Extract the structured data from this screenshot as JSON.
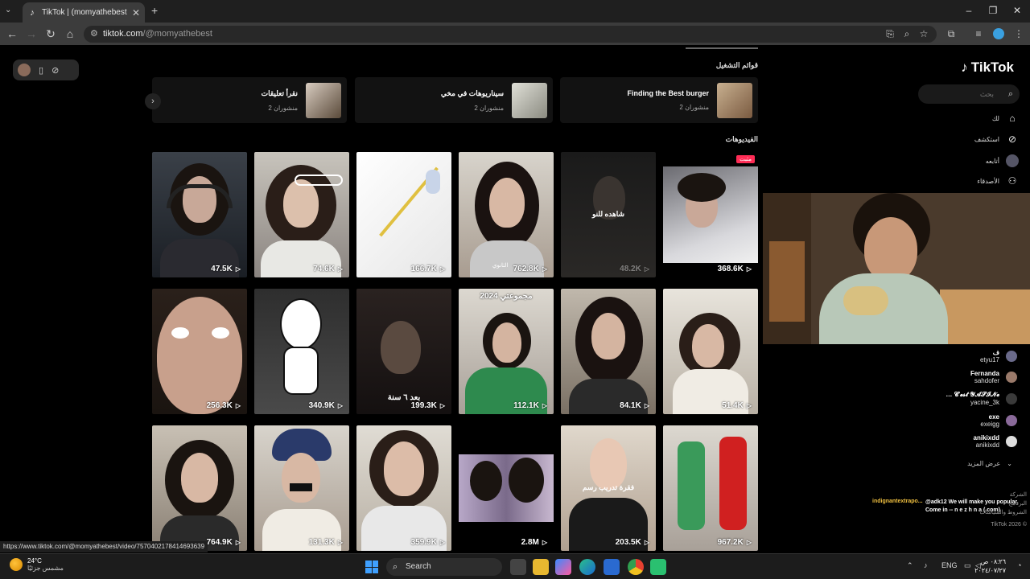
{
  "browser": {
    "tab_title": "‫ئ+ (@momyathebest) | TikTok",
    "url_host": "tiktok.com",
    "url_path": "/@momyathebest",
    "status_url": "https://www.tiktok.com/@momyathebest/video/7570402178414693639"
  },
  "playlists": {
    "title": "قوائم التشغيل",
    "items": [
      {
        "name": "Finding the Best burger",
        "count": "منشوران 2"
      },
      {
        "name": "سيناريوهات في مخي",
        "count": "منشوران 2"
      },
      {
        "name": "نقرأ تعليقات",
        "count": "منشوران 2"
      }
    ]
  },
  "videos": {
    "title": "الفيديوهات",
    "pinned_label": "مثبت",
    "items": [
      {
        "views": "368.6K",
        "overlay": ""
      },
      {
        "views": "48.2K",
        "overlay": "شاهده للنو"
      },
      {
        "views": "762.8K",
        "overlay": "الثانوي"
      },
      {
        "views": "166.7K",
        "overlay": ""
      },
      {
        "views": "74.6K",
        "overlay": ""
      },
      {
        "views": "47.5K",
        "overlay": ""
      },
      {
        "views": "51.4K",
        "overlay": ""
      },
      {
        "views": "84.1K",
        "overlay": ""
      },
      {
        "views": "112.1K",
        "overlay": "مجموعتي 2024"
      },
      {
        "views": "199.3K",
        "overlay": "بعد ٦ سنة"
      },
      {
        "views": "340.9K",
        "overlay": ""
      },
      {
        "views": "256.3K",
        "overlay": ""
      },
      {
        "views": "967.2K",
        "overlay": ""
      },
      {
        "views": "203.5K",
        "overlay": "فقرة تدريب رسم"
      },
      {
        "views": "2.8M",
        "overlay": ""
      },
      {
        "views": "359.9K",
        "overlay": ""
      },
      {
        "views": "131.3K",
        "overlay": ""
      },
      {
        "views": "764.9K",
        "overlay": ""
      }
    ]
  },
  "sidebar": {
    "logo": "TikTok",
    "search_placeholder": "بحث",
    "nav": [
      {
        "label": "لك",
        "icon": "home-icon"
      },
      {
        "label": "استكشف",
        "icon": "compass-icon"
      },
      {
        "label": "أتابعه",
        "icon": "avatar"
      },
      {
        "label": "الأصدقاء",
        "icon": "friends-icon"
      }
    ],
    "following": [
      {
        "name": "ف",
        "handle": "etyu17"
      },
      {
        "name": "Fernanda",
        "handle": "sahdofer"
      },
      {
        "name": "… 𝓒'𝓮𝓼𝓽 𝓨𝓐𝓢𝓘𝓝𝓮",
        "handle": "yacine_3k"
      },
      {
        "name": "exe",
        "handle": "exeigg"
      },
      {
        "name": "anikixdd",
        "handle": "anikixdd"
      }
    ],
    "see_more": "عرض المزيد",
    "footer": [
      "الشركة",
      "البرنامج",
      "الشروط والسياسات",
      "TikTok 2026 ©"
    ]
  },
  "stream_comment": {
    "user": "indignantextrapo...",
    "text": "@adk12 We will make you popular. Come in -- n e z h n a (.com)"
  },
  "taskbar": {
    "temp": "24°C",
    "weather": "مشمس جزئيًا",
    "search": "Search",
    "lang": "ENG",
    "time": "٠٨:٢٦ ص",
    "date": "٢٠٢٤/٠٧/٢٧"
  }
}
